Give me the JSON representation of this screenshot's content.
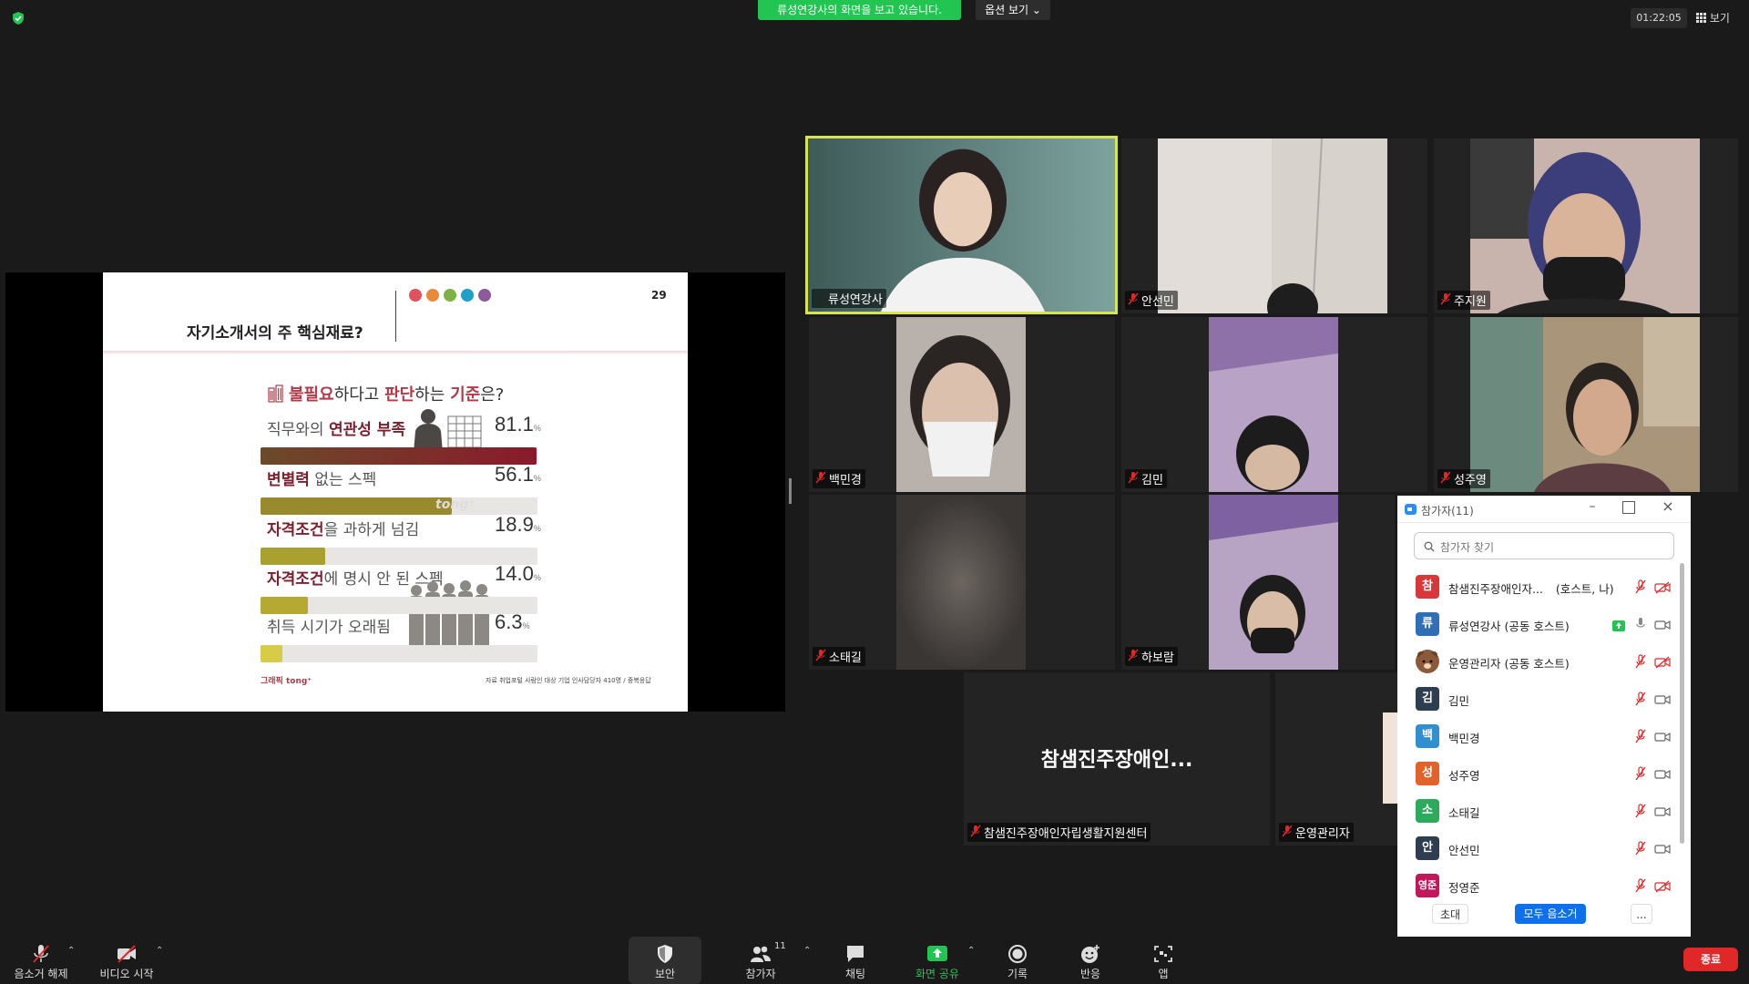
{
  "topbar": {
    "share_banner": "류성연강사의 화면을 보고 있습니다.",
    "view_options": "옵션 보기 ⌄",
    "timer": "01:22:05",
    "view_button": "보기"
  },
  "slide": {
    "page_number": "29",
    "title": "자기소개서의 주 핵심재료?",
    "question_parts": [
      "불필요",
      "하다고 ",
      "판단",
      "하는 ",
      "기준",
      "은?"
    ],
    "dot_colors": [
      "#e0525f",
      "#e98a3b",
      "#7cb342",
      "#1ea0c8",
      "#8e5a9b"
    ],
    "bars": [
      {
        "label_plain1": "직무와의 ",
        "label_bold": "연관성 부족",
        "label_plain2": "",
        "value": "81.1",
        "pct": 81.1,
        "color": "#6b4a2a"
      },
      {
        "label_plain1": "",
        "label_bold": "변별력",
        "label_plain2": " 없는 스펙",
        "value": "56.1",
        "pct": 56.1,
        "color": "#9a8a2e"
      },
      {
        "label_plain1": "",
        "label_bold": "자격조건",
        "label_plain2": "을 과하게 넘김",
        "value": "18.9",
        "pct": 18.9,
        "color": "#a9a030"
      },
      {
        "label_plain1": "",
        "label_bold": "자격조건",
        "label_plain2": "에 명시 안 된 스펙",
        "value": "14.0",
        "pct": 14.0,
        "color": "#b5a833"
      },
      {
        "label_plain1": "",
        "label_bold": "",
        "label_plain2": "취득 시기가 오래됨",
        "value": "6.3",
        "pct": 6.3,
        "color": "#d7cc4a"
      }
    ],
    "percent_sign": "%",
    "watermark": "tong⁺",
    "footer_left": "그래픽 tong⁺",
    "footer_right": "자료 취업포털 사람인   대상 기업 인사담당자 410명 / 중복응답"
  },
  "tiles": [
    {
      "name": "류성연강사",
      "muted": false,
      "active": true
    },
    {
      "name": "안선민",
      "muted": true
    },
    {
      "name": "주지원",
      "muted": true
    },
    {
      "name": "백민경",
      "muted": true
    },
    {
      "name": "김민",
      "muted": true
    },
    {
      "name": "성주영",
      "muted": true
    },
    {
      "name": "소태길",
      "muted": true
    },
    {
      "name": "하보람",
      "muted": true
    },
    {
      "name": "참샘진주장애인자립생활지원센터",
      "muted": true,
      "display": "참샘진주장애인..."
    },
    {
      "name": "운영관리자",
      "muted": true
    }
  ],
  "panel": {
    "title": "참가자(11)",
    "search_placeholder": "참가자 찾기",
    "participants": [
      {
        "initial": "참",
        "name": "참샘진주장애인자...",
        "role": "(호스트, 나)",
        "color": "#d9383a"
      },
      {
        "initial": "류",
        "name": "류성연강사",
        "role": "(공동 호스트)",
        "color": "#2f6fb5"
      },
      {
        "initial": "",
        "name": "운영관리자",
        "role": "(공동 호스트)",
        "color": "#8a5a3a"
      },
      {
        "initial": "김",
        "name": "김민",
        "role": "",
        "color": "#2c3e50"
      },
      {
        "initial": "백",
        "name": "백민경",
        "role": "",
        "color": "#2f8fd0"
      },
      {
        "initial": "성",
        "name": "성주영",
        "role": "",
        "color": "#e2622a"
      },
      {
        "initial": "소",
        "name": "소태길",
        "role": "",
        "color": "#2eaa5c"
      },
      {
        "initial": "안",
        "name": "안선민",
        "role": "",
        "color": "#2c3e50"
      },
      {
        "initial": "영준",
        "name": "정영준",
        "role": "",
        "color": "#c2185b"
      }
    ],
    "invite": "초대",
    "mute_all": "모두 음소거",
    "more": "..."
  },
  "toolbar": {
    "unmute": "음소거 해제",
    "start_video": "비디오 시작",
    "security": "보안",
    "participants": "참가자",
    "participants_count": "11",
    "chat": "채팅",
    "share_screen": "화면 공유",
    "record": "기록",
    "reactions": "반응",
    "apps": "앱",
    "end": "종료"
  }
}
